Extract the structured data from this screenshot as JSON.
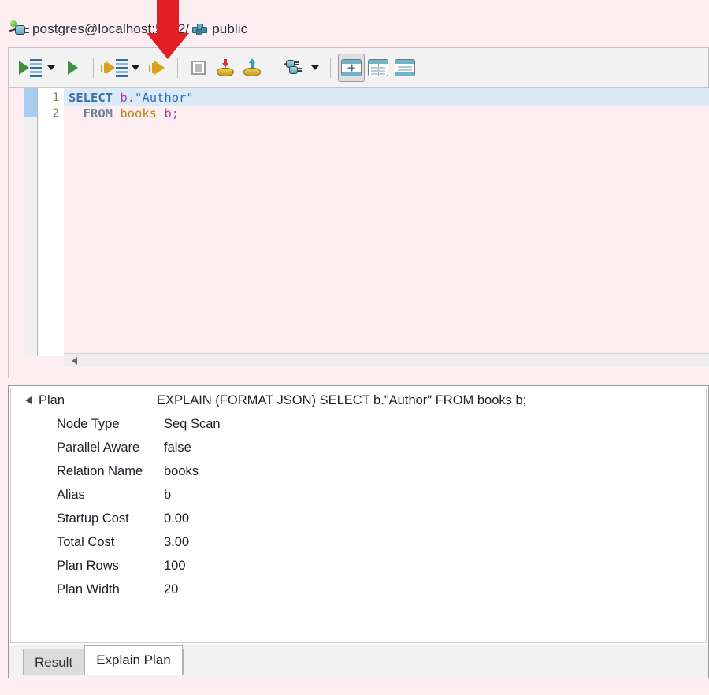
{
  "connection": {
    "icon": "plug-icon",
    "label": "postgres@localhost:5432/",
    "schema_icon": "schema-blocks-icon",
    "schema": "public"
  },
  "toolbar": {
    "buttons": [
      {
        "name": "execute-sql-script",
        "label": "Execute SQL Script"
      },
      {
        "name": "execute-script-dropdown",
        "label": "Execute script options"
      },
      {
        "name": "execute-statement",
        "label": "Execute SQL Statement"
      },
      {
        "name": "explain-execution-plan-script",
        "label": "Explain Execution Plan Script"
      },
      {
        "name": "explain-plan-dropdown",
        "label": "Explain plan options"
      },
      {
        "name": "explain-execution-plan",
        "label": "Explain Execution Plan"
      },
      {
        "name": "stop-execution",
        "label": "Stop"
      },
      {
        "name": "commit",
        "label": "Commit"
      },
      {
        "name": "rollback",
        "label": "Rollback"
      },
      {
        "name": "transaction-mode",
        "label": "Transaction mode"
      },
      {
        "name": "transaction-mode-dropdown",
        "label": "Transaction mode options"
      },
      {
        "name": "layout-vertical",
        "label": "Switch panels layout"
      },
      {
        "name": "layout-horizontal",
        "label": "Switch grid/text"
      },
      {
        "name": "layout-maximize",
        "label": "Maximize results panel"
      }
    ]
  },
  "editor": {
    "lines": [
      {
        "number": "1",
        "highlighted": true
      },
      {
        "number": "2",
        "highlighted": false
      }
    ],
    "line1": {
      "keyword": "SELECT",
      "alias": "b",
      "dot": ".",
      "column": "\"Author\""
    },
    "line2": {
      "keyword": "FROM",
      "table": "books",
      "alias": "b",
      "semicolon": ";"
    },
    "scroll_left_arrow": "scroll-left-arrow"
  },
  "plan": {
    "rows": [
      {
        "key": "Plan",
        "value": "EXPLAIN (FORMAT JSON) SELECT b.\"Author\"  FROM books b;",
        "root": true
      },
      {
        "key": "Node Type",
        "value": "Seq Scan",
        "root": false
      },
      {
        "key": "Parallel Aware",
        "value": "false",
        "root": false
      },
      {
        "key": "Relation Name",
        "value": "books",
        "root": false
      },
      {
        "key": "Alias",
        "value": "b",
        "root": false
      },
      {
        "key": "Startup Cost",
        "value": "0.00",
        "root": false
      },
      {
        "key": "Total Cost",
        "value": "3.00",
        "root": false
      },
      {
        "key": "Plan Rows",
        "value": "100",
        "root": false
      },
      {
        "key": "Plan Width",
        "value": "20",
        "root": false
      }
    ]
  },
  "tabs": {
    "items": [
      {
        "label": "Result",
        "active": false
      },
      {
        "label": "Explain Plan",
        "active": true
      }
    ]
  },
  "annotation": {
    "arrow_color": "#e31f26",
    "arrow_direction": "down",
    "points_to": "explain-execution-plan"
  }
}
